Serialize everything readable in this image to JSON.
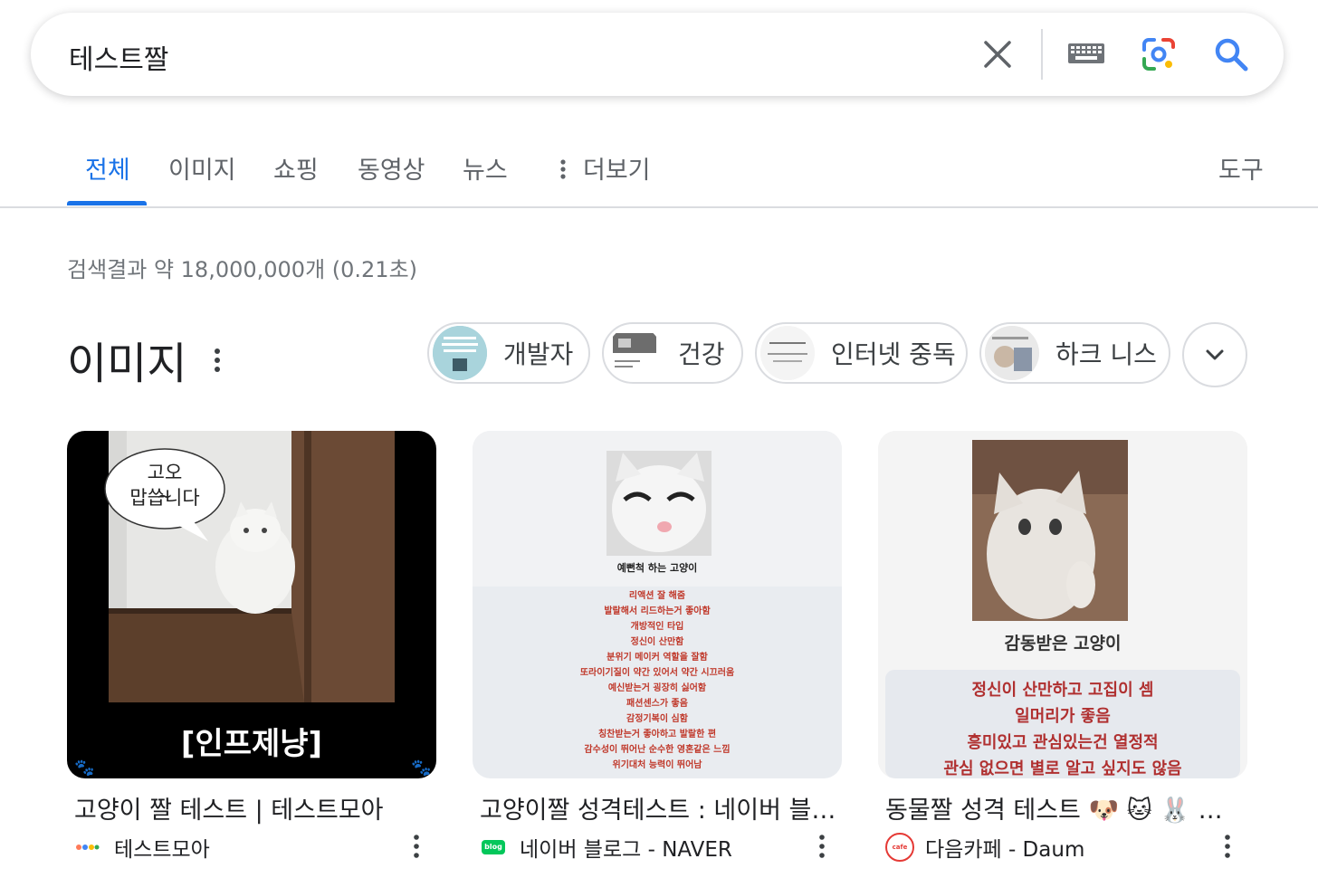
{
  "search": {
    "query": "테스트짤",
    "clear_icon": "close-icon",
    "keyboard_icon": "keyboard-icon",
    "lens_icon": "camera-lens-icon",
    "search_icon": "search-icon"
  },
  "tabs": [
    {
      "label": "전체",
      "active": true
    },
    {
      "label": "이미지"
    },
    {
      "label": "쇼핑"
    },
    {
      "label": "동영상"
    },
    {
      "label": "뉴스"
    },
    {
      "label": "더보기"
    }
  ],
  "tools_label": "도구",
  "stats": "검색결과 약 18,000,000개 (0.21초)",
  "images_section": {
    "title": "이미지",
    "chips": [
      {
        "label": "개발자"
      },
      {
        "label": "건강"
      },
      {
        "label": "인터넷 중독"
      },
      {
        "label": "하크 니스"
      }
    ],
    "results": [
      {
        "overlay_bubble_1": "고오~",
        "overlay_bubble_2": "맙씁니다",
        "overlay_caption": "[인프제냥]",
        "title": "고양이 짤 테스트 | 테스트모아",
        "source": "테스트모아"
      },
      {
        "overlay_caption": "예뻔척 하는 고양이",
        "overlay_lines": [
          "리액션 잘 해줌",
          "발랄해서 리드하는거 좋아함",
          "개방적인 타입",
          "정신이 산만함",
          "분위기 메이커 역할을 잘함",
          "또라이기질이 약간 있어서 약간 시끄러움",
          "예신받는거 굉장히 싫어함",
          "패션센스가 좋음",
          "감정기복이 심함",
          "칭찬받는거 좋아하고 발랄한 편",
          "감수성이 뛰어난 순수한 영혼같은 느낌",
          "위기대처 능력이 뛰어남"
        ],
        "title": "고양이짤 성격테스트 : 네이버 블…",
        "source": "네이버 블로그 - NAVER",
        "source_logo": "blog"
      },
      {
        "overlay_caption": "감동받은 고양이",
        "overlay_lines": [
          "정신이 산만하고 고집이 셈",
          "일머리가 좋음",
          "흥미있고 관심있는건 열정적",
          "관심 없으면 별로 알고 싶지도 않음"
        ],
        "title": "동물짤 성격 테스트 🐶 🐱 🐰 …",
        "source": "다음카페 - Daum",
        "source_logo": "cafe"
      }
    ]
  },
  "colors": {
    "accent": "#1a73e8",
    "text": "#202124",
    "muted": "#70757a",
    "border": "#dadce0"
  }
}
